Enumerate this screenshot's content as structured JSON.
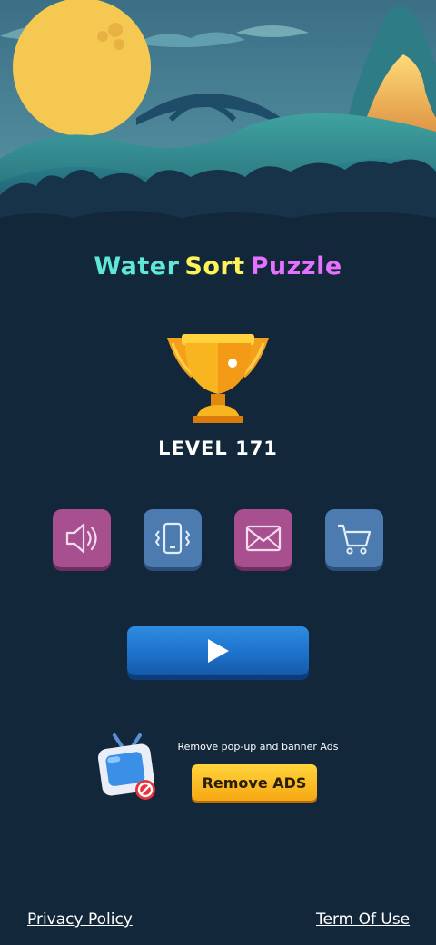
{
  "title": {
    "word1": "Water",
    "word2": "Sort",
    "word3": "Puzzle"
  },
  "level_label": "LEVEL 171",
  "buttons": {
    "sound": "speaker-icon",
    "vibrate": "vibration-icon",
    "mail": "mail-icon",
    "shop": "cart-icon",
    "play": "play-icon"
  },
  "ads": {
    "description": "Remove pop-up and banner Ads",
    "button_label": "Remove ADS"
  },
  "footer": {
    "privacy": "Privacy Policy",
    "terms": "Term Of Use"
  },
  "colors": {
    "background": "#12273a",
    "title_water": "#5fe8d6",
    "title_sort": "#fff35a",
    "title_puzzle": "#e670ff",
    "button_pink": "#a8508f",
    "button_blue": "#4c7bb0",
    "play_blue": "#1d72cc",
    "ads_yellow": "#ffc226"
  }
}
